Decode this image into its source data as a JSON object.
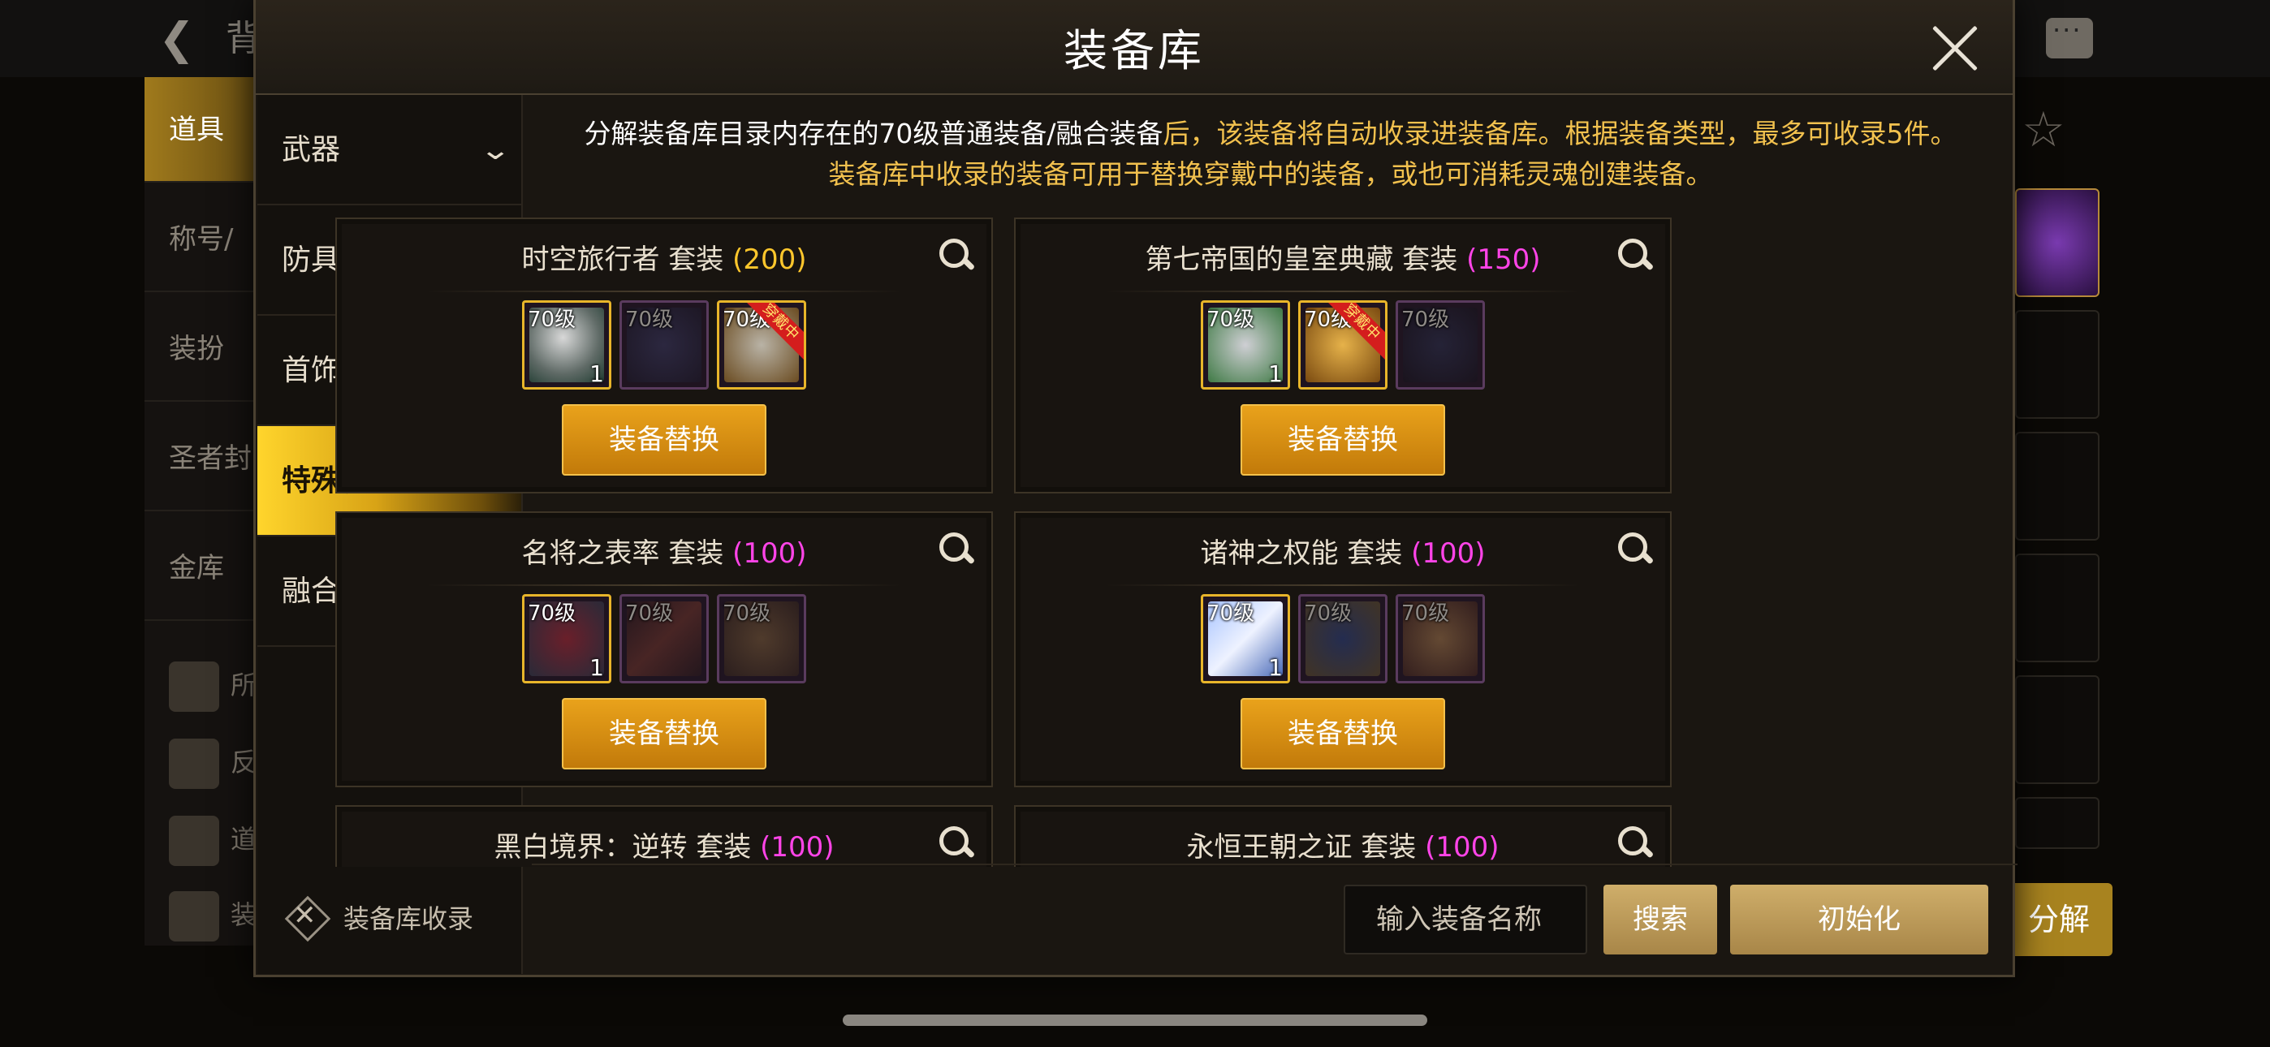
{
  "background": {
    "title": "背",
    "side_items": [
      "道具",
      "称号/",
      "装扮",
      "圣者封",
      "金库"
    ],
    "side_items_lower": [
      "所",
      "反",
      "道",
      "装"
    ],
    "decompose_label": "分解"
  },
  "modal": {
    "title": "装备库",
    "nav": [
      {
        "label": "武器",
        "has_chevron": true
      },
      {
        "label": "防具",
        "has_chevron": false
      },
      {
        "label": "首饰",
        "has_chevron": false
      },
      {
        "label": "特殊装备",
        "has_chevron": false,
        "active": true
      },
      {
        "label": "融合装备",
        "has_chevron": true
      }
    ],
    "nav_chevron": "⌄",
    "nav_footer": "装备库收录",
    "notice": {
      "line1_a": "分解装备库目录内存在的70级普通装备/融合装备",
      "line1_b": "后，该装备将自动收录进装备库。根据装备类型，最多可收录5件。",
      "line2": "装备库中收录的装备可用于替换穿戴中的装备，或也可消耗灵魂创建装备。"
    },
    "sets": [
      {
        "name": "时空旅行者",
        "suffix": "套装",
        "count": "(200)",
        "count_color": "gold",
        "items": [
          {
            "lvl": "70级",
            "qty": "1",
            "owned": true,
            "worn": false
          },
          {
            "lvl": "70级",
            "qty": "",
            "owned": false,
            "worn": false
          },
          {
            "lvl": "70级",
            "qty": "",
            "owned": true,
            "worn": true
          }
        ],
        "button": "装备替换"
      },
      {
        "name": "第七帝国的皇室典藏",
        "suffix": "套装",
        "count": "(150)",
        "count_color": "pink",
        "items": [
          {
            "lvl": "70级",
            "qty": "1",
            "owned": true,
            "worn": false
          },
          {
            "lvl": "70级",
            "qty": "",
            "owned": true,
            "worn": true
          },
          {
            "lvl": "70级",
            "qty": "",
            "owned": false,
            "worn": false
          }
        ],
        "button": "装备替换"
      },
      {
        "name": "名将之表率",
        "suffix": "套装",
        "count": "(100)",
        "count_color": "pink",
        "items": [
          {
            "lvl": "70级",
            "qty": "1",
            "owned": true,
            "worn": false
          },
          {
            "lvl": "70级",
            "qty": "",
            "owned": false,
            "worn": false
          },
          {
            "lvl": "70级",
            "qty": "",
            "owned": false,
            "worn": false
          }
        ],
        "button": "装备替换"
      },
      {
        "name": "诸神之权能",
        "suffix": "套装",
        "count": "(100)",
        "count_color": "pink",
        "items": [
          {
            "lvl": "70级",
            "qty": "1",
            "owned": true,
            "worn": false
          },
          {
            "lvl": "70级",
            "qty": "",
            "owned": false,
            "worn": false
          },
          {
            "lvl": "70级",
            "qty": "",
            "owned": false,
            "worn": false
          }
        ],
        "button": "装备替换"
      },
      {
        "name": "黑白境界：逆转",
        "suffix": "套装",
        "count": "(100)",
        "count_color": "pink",
        "items": [],
        "button": ""
      },
      {
        "name": "永恒王朝之证",
        "suffix": "套装",
        "count": "(100)",
        "count_color": "pink",
        "items": [],
        "button": ""
      }
    ],
    "worn_label": "穿戴中",
    "search_placeholder": "输入装备名称",
    "search_button": "搜索",
    "reset_button": "初始化"
  },
  "colors": {
    "accent_gold": "#e9a21b",
    "count_pink": "#ff44e8",
    "count_gold": "#ffc72c"
  }
}
